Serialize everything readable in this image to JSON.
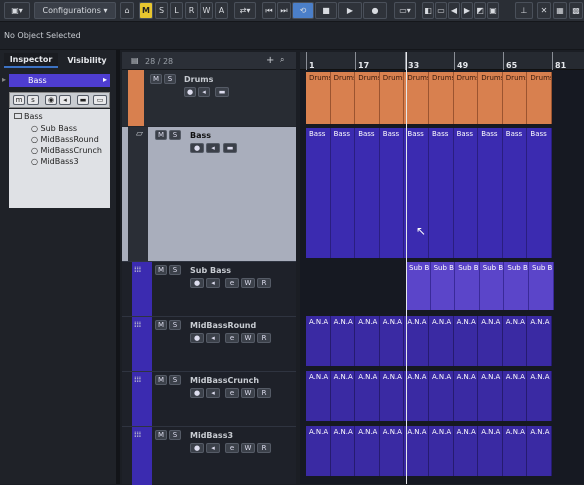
{
  "toolbar": {
    "config_label": "Configurations",
    "modes": [
      "M",
      "S",
      "L",
      "R",
      "W",
      "A"
    ]
  },
  "status": {
    "text": "No Object Selected"
  },
  "inspector": {
    "tabs": [
      "Inspector",
      "Visibility"
    ],
    "track_name": "Bass",
    "folder": "Bass",
    "children": [
      "Sub Bass",
      "MidBassRound",
      "MidBassCrunch",
      "MidBass3"
    ]
  },
  "tracklist": {
    "count": "28 / 28",
    "tracks": [
      {
        "name": "Drums"
      },
      {
        "name": "Bass"
      },
      {
        "name": "Sub Bass"
      },
      {
        "name": "MidBassRound"
      },
      {
        "name": "MidBassCrunch"
      },
      {
        "name": "MidBass3"
      }
    ]
  },
  "ruler": {
    "labels": [
      "1",
      "17",
      "33",
      "49",
      "65",
      "81"
    ]
  },
  "clips": {
    "drums": "Drums",
    "bass": "Bass",
    "sub": "Sub B",
    "ana": "A.N.A"
  },
  "colors": {
    "drums": "#d8804f",
    "bass_folder": "#3b2bb0",
    "accent": "#4b7fc9",
    "yellow": "#e8c62f"
  }
}
